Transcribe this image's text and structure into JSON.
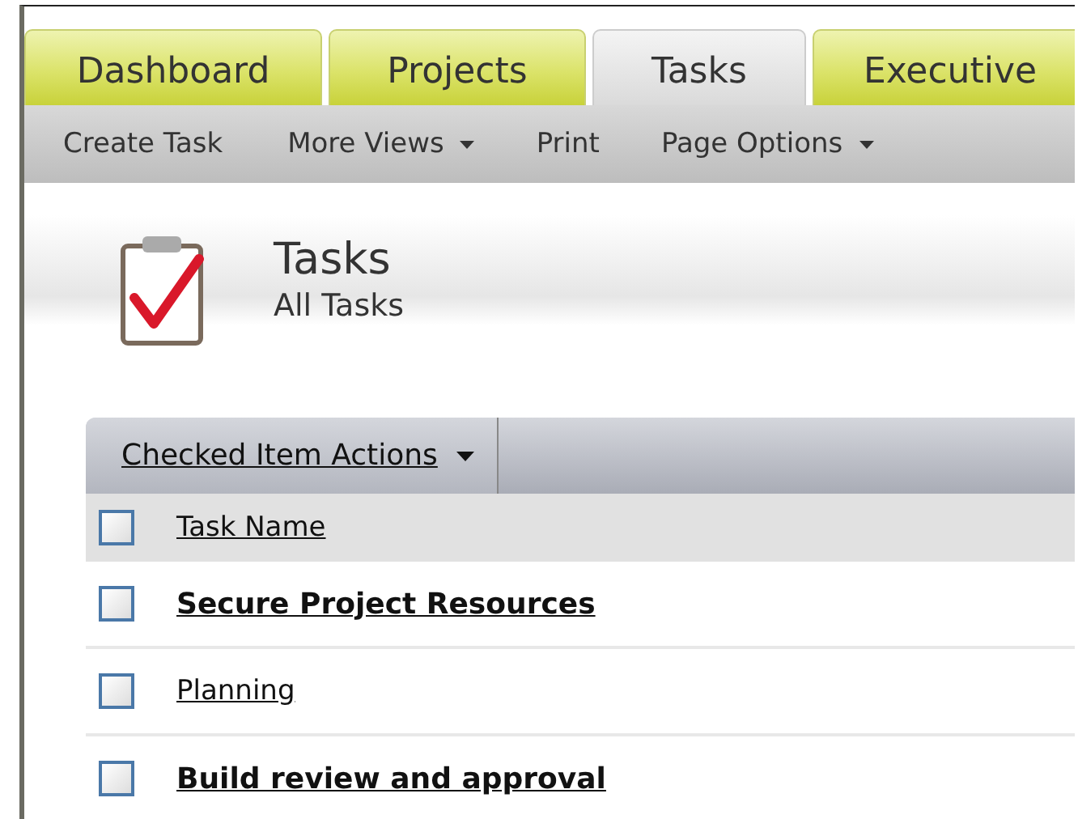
{
  "tabs": [
    {
      "label": "Dashboard",
      "selected": false
    },
    {
      "label": "Projects",
      "selected": false
    },
    {
      "label": "Tasks",
      "selected": true
    },
    {
      "label": "Executive",
      "selected": false
    }
  ],
  "toolbar": [
    {
      "label": "Create Task",
      "dropdown": false
    },
    {
      "label": "More Views",
      "dropdown": true
    },
    {
      "label": "Print",
      "dropdown": false
    },
    {
      "label": "Page Options",
      "dropdown": true
    }
  ],
  "page_header": {
    "title": "Tasks",
    "subtitle": "All Tasks"
  },
  "actions": {
    "label": "Checked Item Actions"
  },
  "table": {
    "header": {
      "label": "Task Name",
      "checked": false
    },
    "rows": [
      {
        "name": "Secure Project Resources",
        "kind": "summary",
        "checked": false
      },
      {
        "name": "Planning",
        "kind": "task",
        "checked": false
      },
      {
        "name": "Build review and approval",
        "kind": "summary",
        "checked": false
      }
    ]
  }
}
